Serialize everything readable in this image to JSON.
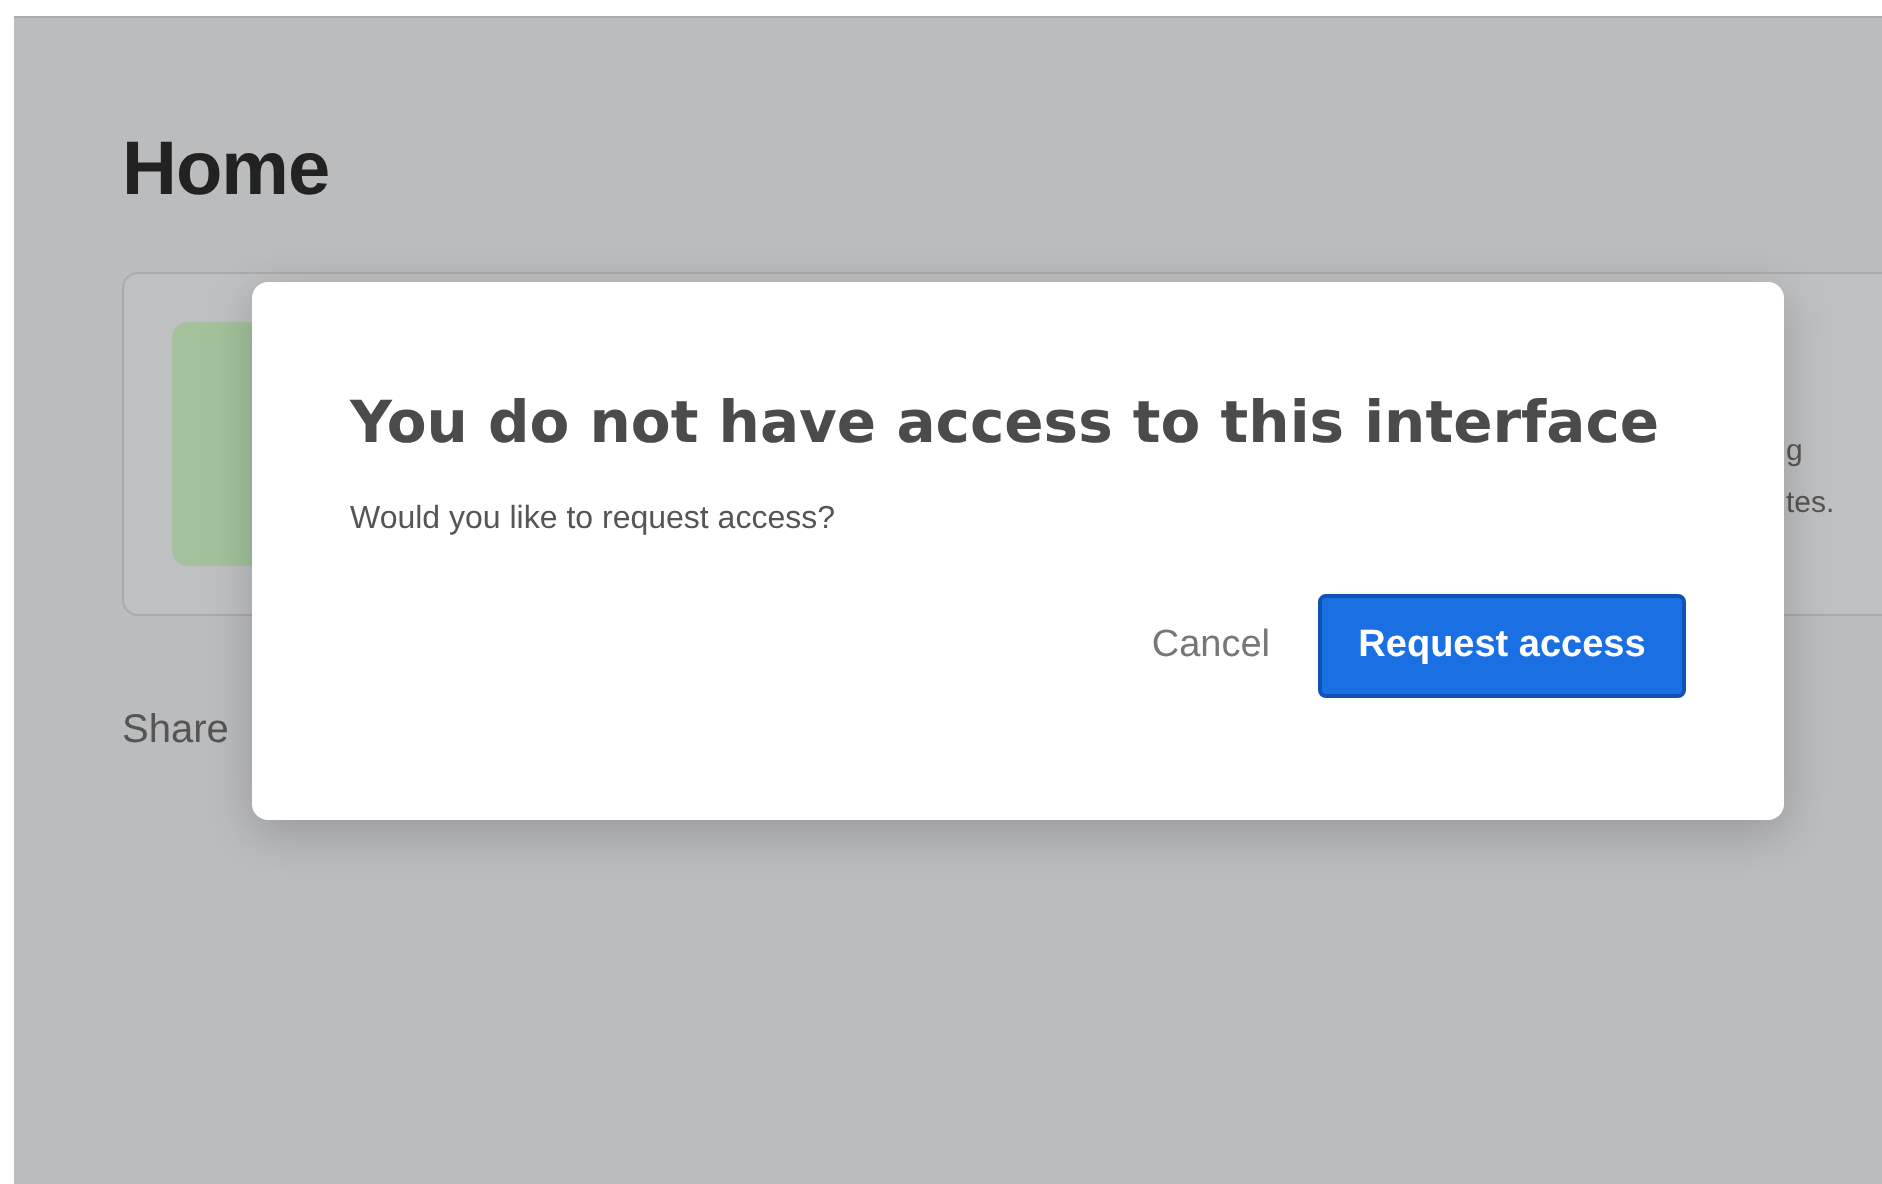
{
  "page": {
    "title": "Home",
    "card": {
      "text_lines": [
        "g",
        "tes."
      ]
    },
    "section_label": "Share"
  },
  "dialog": {
    "title": "You do not have access to this interface",
    "message": "Would you like to request access?",
    "buttons": [
      {
        "label": "Cancel",
        "kind": "secondary"
      },
      {
        "label": "Request access",
        "kind": "primary"
      }
    ]
  }
}
